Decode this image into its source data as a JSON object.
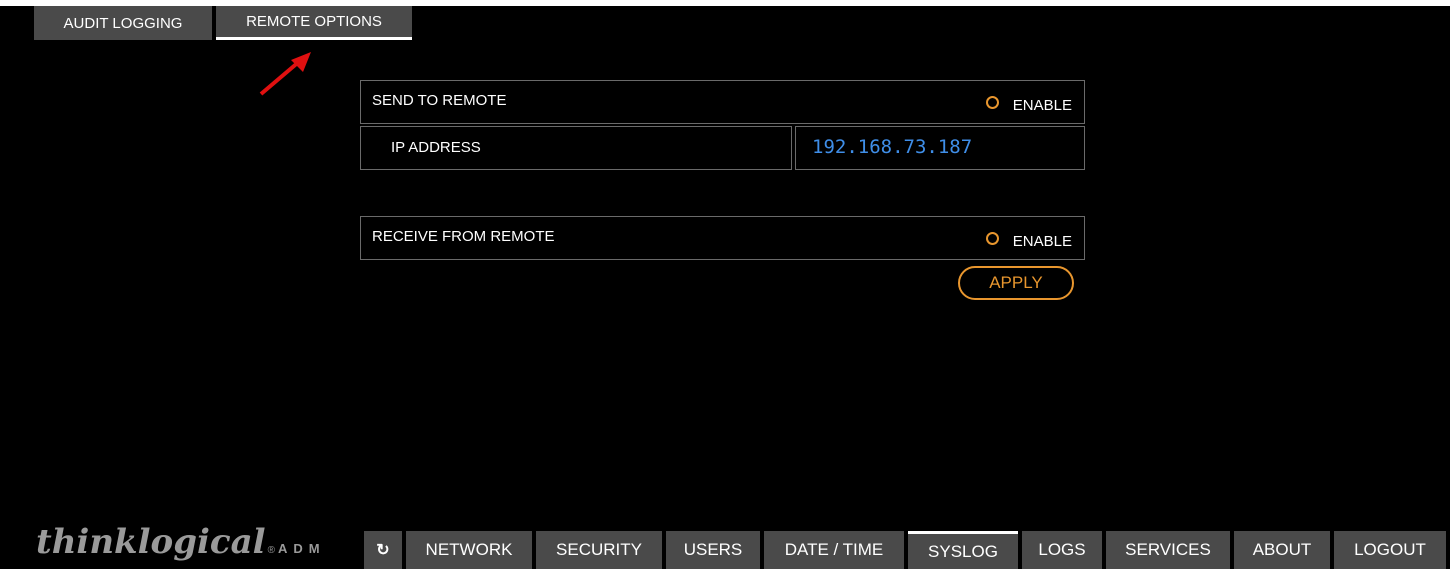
{
  "subtabs": [
    {
      "label": "AUDIT LOGGING",
      "active": false
    },
    {
      "label": "REMOTE OPTIONS",
      "active": true
    }
  ],
  "send_remote": {
    "label": "SEND TO REMOTE",
    "enable_label": "ENABLE",
    "enabled": false
  },
  "ip_address": {
    "label": "IP ADDRESS",
    "value": "192.168.73.187"
  },
  "receive_remote": {
    "label": "RECEIVE FROM REMOTE",
    "enable_label": "ENABLE",
    "enabled": false
  },
  "apply_label": "APPLY",
  "logo": {
    "main": "thinklogical",
    "reg": "®",
    "sub": "ADM"
  },
  "nav": {
    "refresh_icon": "↻",
    "items": [
      {
        "label": "NETWORK",
        "active": false
      },
      {
        "label": "SECURITY",
        "active": false
      },
      {
        "label": "USERS",
        "active": false
      },
      {
        "label": "DATE / TIME",
        "active": false
      },
      {
        "label": "SYSLOG",
        "active": true
      },
      {
        "label": "LOGS",
        "active": false
      },
      {
        "label": "SERVICES",
        "active": false
      },
      {
        "label": "ABOUT",
        "active": false
      },
      {
        "label": "LOGOUT",
        "active": false
      }
    ]
  },
  "colors": {
    "accent": "#e8962e",
    "ip_text": "#3f8ee8",
    "tab_bg": "#4a4a4a"
  }
}
